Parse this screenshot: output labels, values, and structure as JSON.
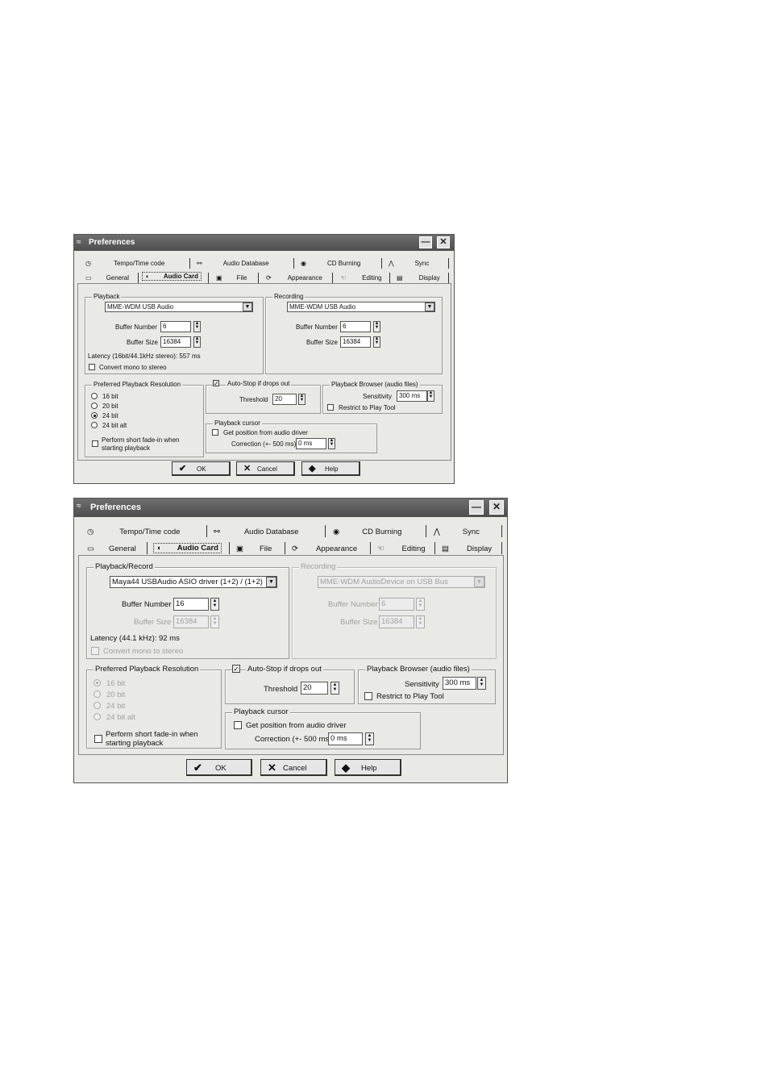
{
  "window_title": "Preferences",
  "tabs_row1": [
    "Tempo/Time code",
    "Audio Database",
    "CD Burning",
    "Sync"
  ],
  "tabs_row2": [
    "General",
    "Audio Card",
    "File",
    "Appearance",
    "Editing",
    "Display"
  ],
  "buttons": {
    "ok": "OK",
    "cancel": "Cancel",
    "help": "Help"
  },
  "dialog1": {
    "playback": {
      "title": "Playback",
      "device": "MME-WDM USB Audio",
      "buffer_number_label": "Buffer Number",
      "buffer_number": "6",
      "buffer_size_label": "Buffer Size",
      "buffer_size": "16384",
      "latency": "Latency (16bit/44.1kHz stereo): 557 ms",
      "convert_mono": "Convert mono to stereo"
    },
    "recording": {
      "title": "Recording",
      "device": "MME-WDM USB Audio",
      "buffer_number_label": "Buffer Number",
      "buffer_number": "6",
      "buffer_size_label": "Buffer Size",
      "buffer_size": "16384"
    },
    "resolution": {
      "title": "Preferred Playback Resolution",
      "options": [
        "16 bit",
        "20 bit",
        "24 bit",
        "24 bit alt"
      ],
      "selected": "24 bit"
    },
    "fadein": {
      "line1": "Perform short fade-in when",
      "line2": "starting playback"
    },
    "autostop": {
      "label": "Auto-Stop if drops out",
      "threshold_label": "Threshold",
      "threshold": "20"
    },
    "browser": {
      "title": "Playback Browser (audio files)",
      "sensitivity_label": "Sensitivity",
      "sensitivity": "300 ms",
      "restrict": "Restrict to Play Tool"
    },
    "cursor": {
      "title": "Playback cursor",
      "get_position": "Get position from audio driver",
      "correction_label": "Correction (+- 500 ms)",
      "correction": "0 ms"
    }
  },
  "dialog2": {
    "playback": {
      "title": "Playback/Record",
      "device": "Maya44 USBAudio ASIO driver (1+2) / (1+2)",
      "buffer_number_label": "Buffer Number",
      "buffer_number": "16",
      "buffer_size_label": "Buffer Size",
      "buffer_size": "16384",
      "latency": "Latency (44.1 kHz): 92 ms",
      "convert_mono": "Convert mono to stereo"
    },
    "recording": {
      "title": "Recording",
      "device": "MME-WDM AudioDevice on USB Bus",
      "buffer_number_label": "Buffer Number",
      "buffer_number": "6",
      "buffer_size_label": "Buffer Size",
      "buffer_size": "16384"
    },
    "resolution": {
      "title": "Preferred Playback Resolution",
      "options": [
        "16 bit",
        "20 bit",
        "24 bit",
        "24 bit alt"
      ],
      "selected": "16 bit"
    },
    "fadein": {
      "line1": "Perform short fade-in when",
      "line2": "starting playback"
    },
    "autostop": {
      "label": "Auto-Stop if drops out",
      "threshold_label": "Threshold",
      "threshold": "20"
    },
    "browser": {
      "title": "Playback Browser (audio files)",
      "sensitivity_label": "Sensitivity",
      "sensitivity": "300 ms",
      "restrict": "Restrict to Play Tool"
    },
    "cursor": {
      "title": "Playback cursor",
      "get_position": "Get position from audio driver",
      "correction_label": "Correction (+- 500 ms)",
      "correction": "0 ms"
    }
  }
}
